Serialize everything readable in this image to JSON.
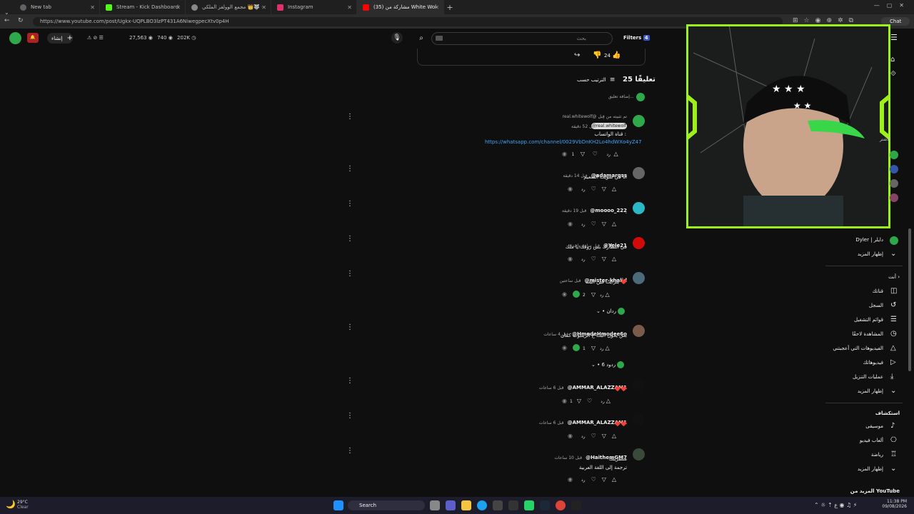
{
  "browser": {
    "tabs": [
      {
        "title": "New tab",
        "color": "#5f6368"
      },
      {
        "title": "Stream - Kick Dashboard",
        "color": "#53fc18"
      },
      {
        "title": "مجمع الوولفز الملكي 👑🐺 - What",
        "color": "#25d366"
      },
      {
        "title": "Instagram",
        "color": "#e1306c"
      },
      {
        "title": "(35) مشاركة من White Wolf - واتـ",
        "color": "#ff0000"
      }
    ],
    "url": "https://www.youtube.com/post/Ugkx-UQPLBO3lzPT431A6NiwegpecXtv0p4H",
    "chat_label": "Chat"
  },
  "header": {
    "create_label": "إنشاء",
    "stats": {
      "views": "27,563",
      "likes": "740",
      "subs": "202K"
    },
    "search_placeholder": "بحث",
    "filters_label": "Filters",
    "filters_count": "4"
  },
  "post": {
    "like_count": "24"
  },
  "comments_header": {
    "count_label": "25 تعليقًا",
    "sort_label": "الترتيب حسب",
    "add_placeholder": "إضافة تعليق..."
  },
  "comments": [
    {
      "author": "real.whitewolf@ تم تثبيته من قِبل",
      "tag": "@real.whitewolf",
      "time": "قبل 52 دقيقة",
      "lines": [
        "قناة الواتساب :"
      ],
      "link": "https://whatsapp.com/channel/0029VbDnKH2Lo4hdWXo4yZ47",
      "likes": "1",
      "reply": "رد",
      "avatar": "#2ea84a"
    },
    {
      "author": "@adamarqss",
      "time": "قبل 14 دقيقة",
      "lines": [
        "انا في سويت السعيم"
      ],
      "likes": "",
      "reply": "رد",
      "avatar": "#666666"
    },
    {
      "author": "@moooo_222",
      "time": "قبل 19 دقيقة",
      "lines": [
        "."
      ],
      "likes": "",
      "reply": "رد",
      "avatar": "#2bb8c4"
    },
    {
      "author": "@Yele21",
      "time": "قبل ساعة واحدة",
      "lines": [
        "في انتظارك بس روقك يا ملك"
      ],
      "likes": "",
      "reply": "رد",
      "avatar": "#d10a0a"
    },
    {
      "author": "@mister-khalid",
      "time": "قبل ساعتين",
      "lines": [
        "بلرايت فين البث ❤️"
      ],
      "likes": "2",
      "reply": "رد",
      "avatar": "#4b6b7a",
      "replies_label": "• ردان"
    },
    {
      "author": "@HmodeHmodee6o",
      "time": "قبل 4 ساعات",
      "lines": [
        "بس يكون البث ع الريلبوب كمان"
      ],
      "likes": "1",
      "reply": "رد",
      "avatar": "#7a5a4a",
      "replies_label": "• 6 ردود"
    },
    {
      "author": "@AMMAR_ALAZZAM1",
      "time": "قبل 6 ساعات",
      "lines": [
        "❤️❤️"
      ],
      "likes": "1",
      "reply": "رد",
      "avatar": "#111111"
    },
    {
      "author": "@AMMAR_ALAZZAM1",
      "time": "قبل 6 ساعات",
      "lines": [
        "❤️❤️"
      ],
      "likes": "",
      "reply": "رد",
      "avatar": "#111111"
    },
    {
      "author": "@HaithemGM7",
      "time": "قبل 10 ساعات",
      "lines": [
        "منظرينك",
        "ترجمة إلى اللغة العربية"
      ],
      "likes": "",
      "reply": "رد",
      "avatar": "#3a4a3a"
    }
  ],
  "sidebar": {
    "section_label": "الاشتر",
    "channel_name": "Dyler | دايلر",
    "show_more_1": "إظهار المزيد",
    "you_label": "أنت",
    "items": [
      "قناتك",
      "السجل",
      "قوائم التشغيل",
      "المشاهدة لاحقًا",
      "الفيديوهات التي أعجبتني",
      "فيديوهاتك",
      "عمليات التنزيل"
    ],
    "show_more_2": "إظهار المزيد",
    "explore_label": "استكشاف",
    "explore_items": [
      "موسيقى",
      "ألعاب فيديو",
      "رياضة"
    ],
    "show_more_3": "إظهار المزيد",
    "more_from": "المزيد من YouTube"
  },
  "taskbar": {
    "weather_temp": "29°C",
    "weather_desc": "Clear",
    "search_label": "Search",
    "time": "11:38 PM",
    "date": "09/08/2026"
  }
}
